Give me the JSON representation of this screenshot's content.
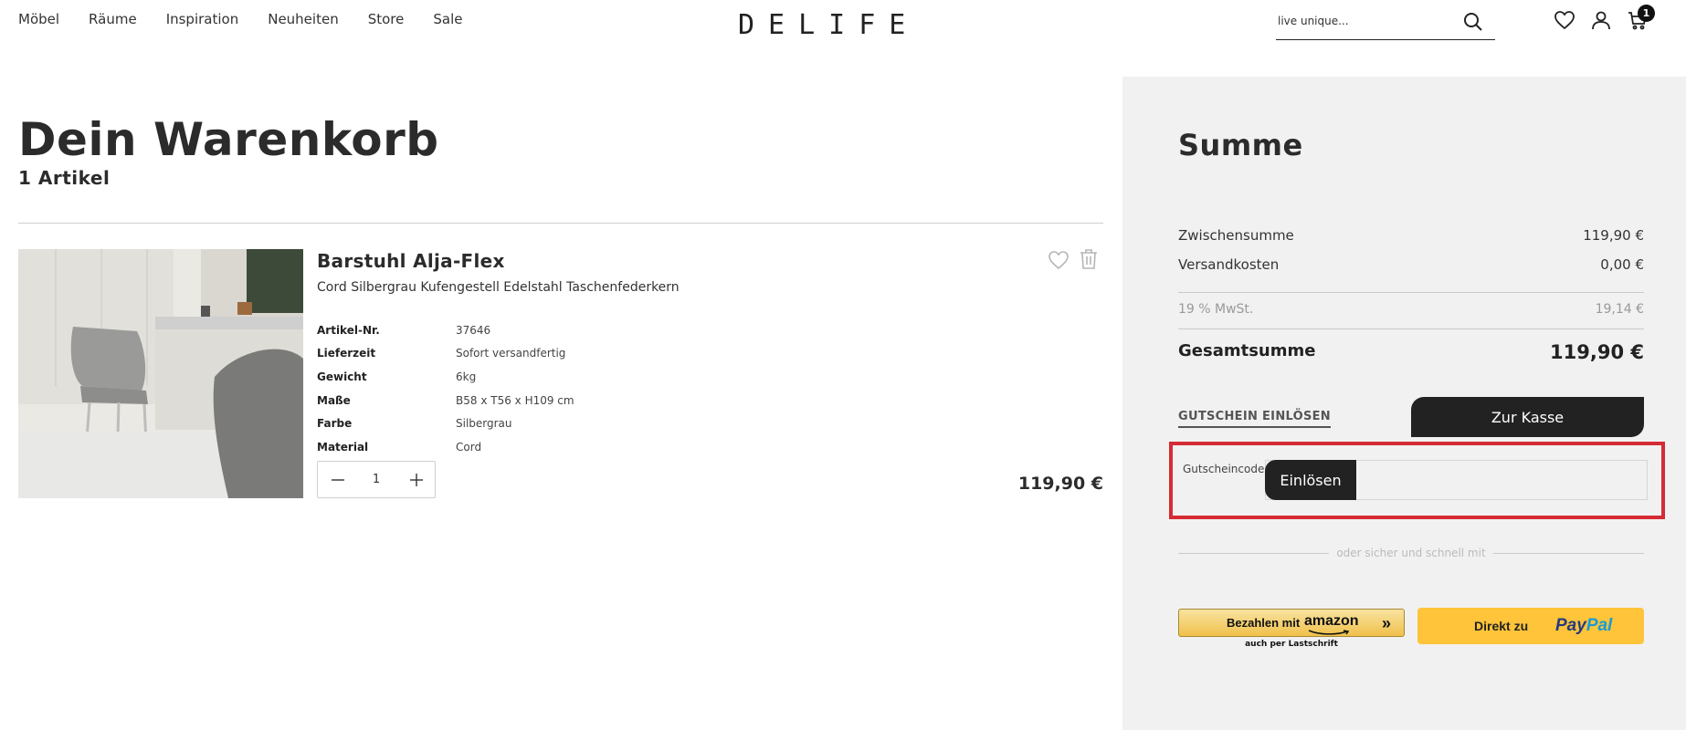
{
  "nav": {
    "items": [
      "Möbel",
      "Räume",
      "Inspiration",
      "Neuheiten",
      "Store",
      "Sale"
    ]
  },
  "logo": "DELIFE",
  "search": {
    "placeholder": "live unique..."
  },
  "cart": {
    "badge_count": "1"
  },
  "page": {
    "title": "Dein Warenkorb",
    "item_count": "1 Artikel"
  },
  "product": {
    "name": "Barstuhl Alja-Flex",
    "description": "Cord Silbergrau Kufengestell Edelstahl Taschenfederkern",
    "specs": [
      {
        "label": "Artikel-Nr.",
        "value": "37646"
      },
      {
        "label": "Lieferzeit",
        "value": "Sofort versandfertig"
      },
      {
        "label": "Gewicht",
        "value": "6kg"
      },
      {
        "label": "Maße",
        "value": "B58 x T56 x H109 cm"
      },
      {
        "label": "Farbe",
        "value": "Silbergrau"
      },
      {
        "label": "Material",
        "value": "Cord"
      }
    ],
    "quantity": "1",
    "price": "119,90 €"
  },
  "summary": {
    "title": "Summe",
    "subtotal_label": "Zwischensumme",
    "subtotal_value": "119,90 €",
    "shipping_label": "Versandkosten",
    "shipping_value": "0,00 €",
    "vat_label": "19 % MwSt.",
    "vat_value": "19,14 €",
    "total_label": "Gesamtsumme",
    "total_value": "119,90 €"
  },
  "voucher": {
    "toggle_label": "GUTSCHEIN EINLÖSEN",
    "field_label": "Gutscheincode",
    "redeem_label": "Einlösen"
  },
  "checkout_label": "Zur Kasse",
  "express": {
    "divider_text": "oder sicher und schnell mit",
    "amazon_label": "Bezahlen mit",
    "amazon_brand": "amazon",
    "amazon_sub": "auch per Lastschrift",
    "paypal_label": "Direkt zu",
    "paypal_brand_part1": "Pay",
    "paypal_brand_part2": "Pal"
  },
  "colors": {
    "accent_dark": "#222222",
    "panel_bg": "#f1f1f1",
    "highlight_red": "#d52b34",
    "paypal_yellow": "#ffc439",
    "amazon_yellow": "#f0c14b"
  }
}
